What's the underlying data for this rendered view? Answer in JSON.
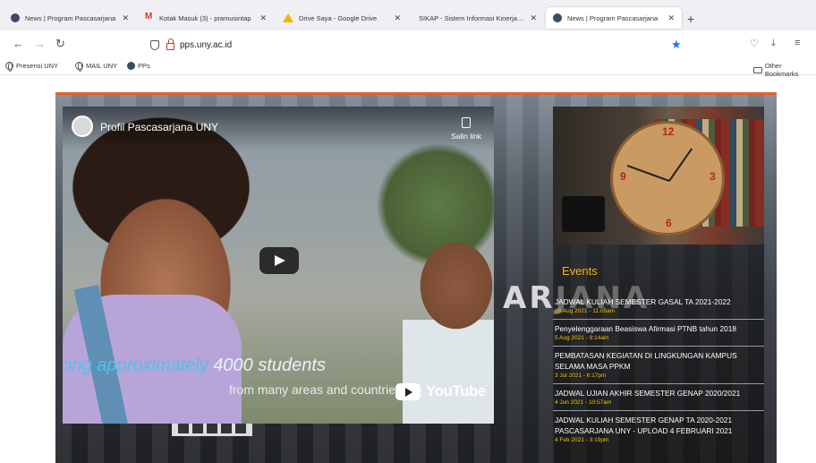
{
  "browser": {
    "tabs": [
      {
        "title": "News | Program Pascasarjana",
        "favicon": "uny-icon",
        "active": false
      },
      {
        "title": "Kotak Masuk (3) - pramusintap",
        "favicon": "gmail-icon",
        "active": false
      },
      {
        "title": "Drive Saya - Google Drive",
        "favicon": "drive-icon",
        "active": false
      },
      {
        "title": "SIKAP - Sistem Informasi Kinerja Pe",
        "favicon": "none",
        "active": false
      },
      {
        "title": "News | Program Pascasarjana",
        "favicon": "uny-icon",
        "active": true
      }
    ],
    "new_tab": "+",
    "url": "pps.uny.ac.id",
    "bookmarks": [
      {
        "label": "Presensi UNY",
        "icon": "globe-icon"
      },
      {
        "label": "MAIL UNY",
        "icon": "globe-icon"
      },
      {
        "label": "PPs",
        "icon": "uny-icon"
      }
    ],
    "other_bookmarks": "Other Bookmarks",
    "accent_color": "#1a73e8"
  },
  "hero": {
    "building_text": "ARJANA",
    "video": {
      "channel_title": "Profil Pascasarjana UNY",
      "copy_link_label": "Salin link",
      "caption_line1_highlight": "cing approximately",
      "caption_line1_rest": " 4000 students",
      "caption_line2": "from many areas and countries",
      "brand": "YouTube"
    },
    "events": {
      "heading": "Events",
      "items": [
        {
          "title": "JADWAL KULIAH SEMESTER GASAL TA 2021-2022",
          "date": "16 Aug 2021 - 11:05am"
        },
        {
          "title": "Penyelenggaraan Beasiswa Afirmasi PTNB tahun 2018",
          "date": "5 Aug 2021 - 9:14am"
        },
        {
          "title": "PEMBATASAN KEGIATAN DI LINGKUNGAN KAMPUS SELAMA MASA PPKM",
          "date": "3 Jul 2021 - 6:17pm"
        },
        {
          "title": "JADWAL UJIAN AKHIR SEMESTER GENAP 2020/2021",
          "date": "4 Jun 2021 - 10:57am"
        },
        {
          "title": "JADWAL KULIAH SEMESTER GENAP TA 2020-2021 PASCASARJANA UNY - UPLOAD 4 FEBRUARI 2021",
          "date": "4 Feb 2021 - 3:19pm"
        }
      ],
      "heading_color": "#f5b400",
      "date_color": "#f5c400"
    },
    "accent_line_color": "#e0632e"
  }
}
